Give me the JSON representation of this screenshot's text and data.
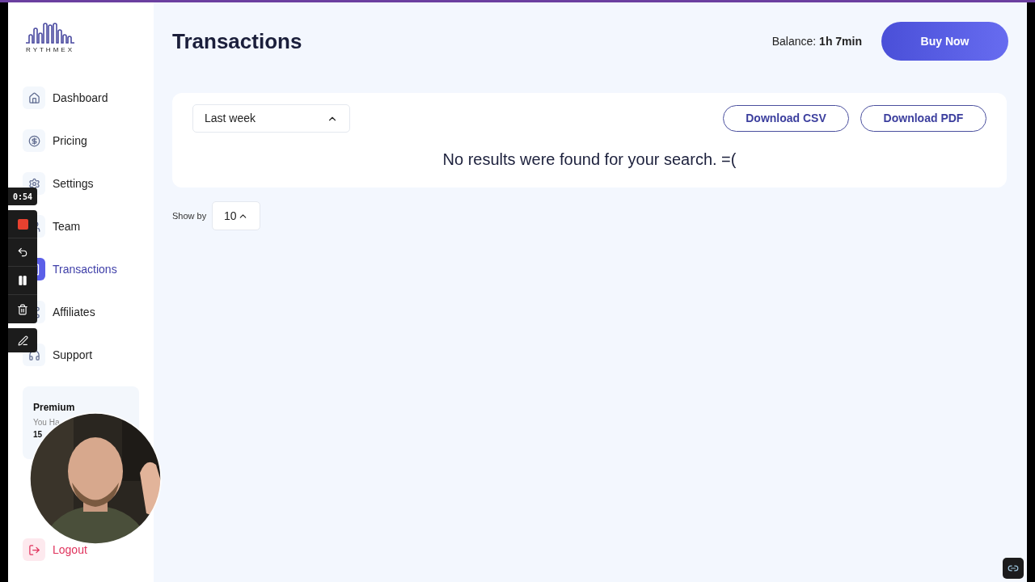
{
  "logo": {
    "text": "RYTHMEX"
  },
  "sidebar": {
    "items": [
      {
        "label": "Dashboard",
        "selected": false
      },
      {
        "label": "Pricing",
        "selected": false
      },
      {
        "label": "Settings",
        "selected": false
      },
      {
        "label": "Team",
        "selected": false
      },
      {
        "label": "Transactions",
        "selected": true
      },
      {
        "label": "Affiliates",
        "selected": false
      },
      {
        "label": "Support",
        "selected": false
      }
    ],
    "plan_card": {
      "title": "Premium",
      "line_1": "You Ha",
      "line_2": "15"
    },
    "logout": {
      "label": "Logout"
    }
  },
  "header": {
    "title": "Transactions",
    "balance_label": "Balance:",
    "balance_value": "1h 7min",
    "buy_button": "Buy Now"
  },
  "filter": {
    "period": "Last week",
    "buttons": [
      "Download CSV",
      "Download PDF"
    ],
    "empty_message": "No results were found for your search. =("
  },
  "pagination": {
    "label": "Show by",
    "page_size": "10"
  },
  "recorder": {
    "timer": "0:54"
  }
}
